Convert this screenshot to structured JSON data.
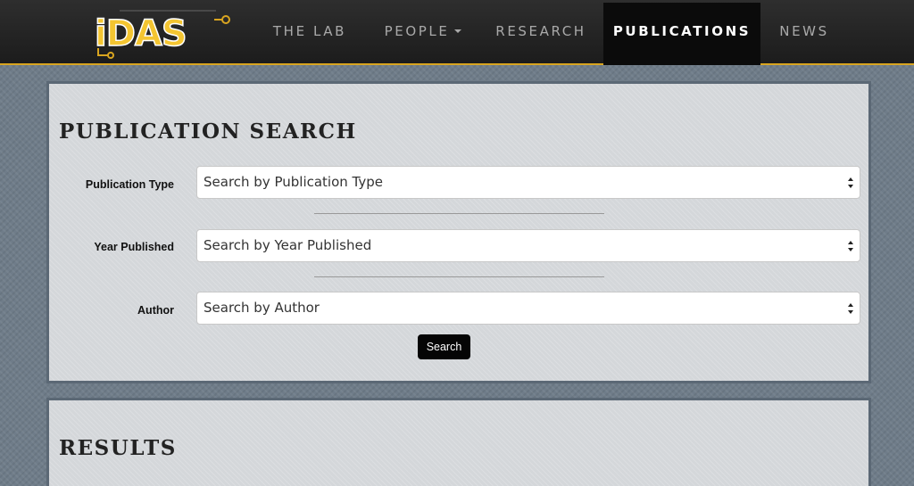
{
  "nav": {
    "items": [
      {
        "label": "THE LAB"
      },
      {
        "label": "PEOPLE"
      },
      {
        "label": "RESEARCH"
      },
      {
        "label": "PUBLICATIONS"
      },
      {
        "label": "NEWS"
      }
    ],
    "active": "PUBLICATIONS",
    "logo_text": "iDAS"
  },
  "search": {
    "title": "PUBLICATION SEARCH",
    "fields": [
      {
        "label": "Publication Type",
        "value": "Search by Publication Type"
      },
      {
        "label": "Year Published",
        "value": "Search by Year Published"
      },
      {
        "label": "Author",
        "value": "Search by Author"
      }
    ],
    "button_label": "Search"
  },
  "results": {
    "title": "RESULTS"
  },
  "colors": {
    "accent": "#d9a520",
    "nav_bg": "#1c1c1c",
    "panel_bg": "#d4d7da",
    "page_bg": "#6f7c89",
    "button_bg": "#050505"
  }
}
